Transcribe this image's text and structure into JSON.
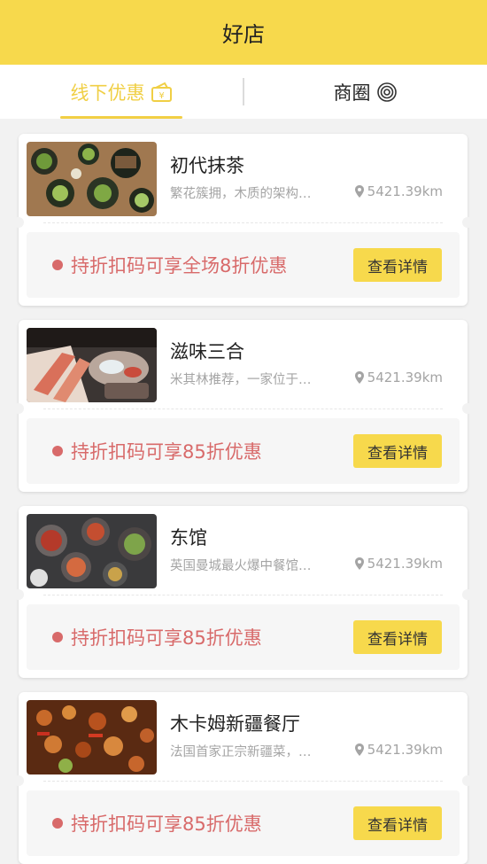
{
  "header": {
    "title": "好店"
  },
  "tabs": [
    {
      "label": "线下优惠",
      "icon": "wallet-icon"
    },
    {
      "label": "商圈",
      "icon": "target-icon"
    }
  ],
  "colors": {
    "accent": "#f7d94c",
    "offer": "#d86a6a"
  },
  "stores": [
    {
      "name": "初代抹茶",
      "desc": "繁花簇拥，木质的架构…",
      "distance": "5421.39km",
      "offer": "持折扣码可享全场8折优惠",
      "button": "查看详情"
    },
    {
      "name": "滋味三合",
      "desc": "米其林推荐，一家位于…",
      "distance": "5421.39km",
      "offer": "持折扣码可享85折优惠",
      "button": "查看详情"
    },
    {
      "name": "东馆",
      "desc": "英国曼城最火爆中餐馆…",
      "distance": "5421.39km",
      "offer": "持折扣码可享85折优惠",
      "button": "查看详情"
    },
    {
      "name": "木卡姆新疆餐厅",
      "desc": "法国首家正宗新疆菜，…",
      "distance": "5421.39km",
      "offer": "持折扣码可享85折优惠",
      "button": "查看详情"
    }
  ]
}
